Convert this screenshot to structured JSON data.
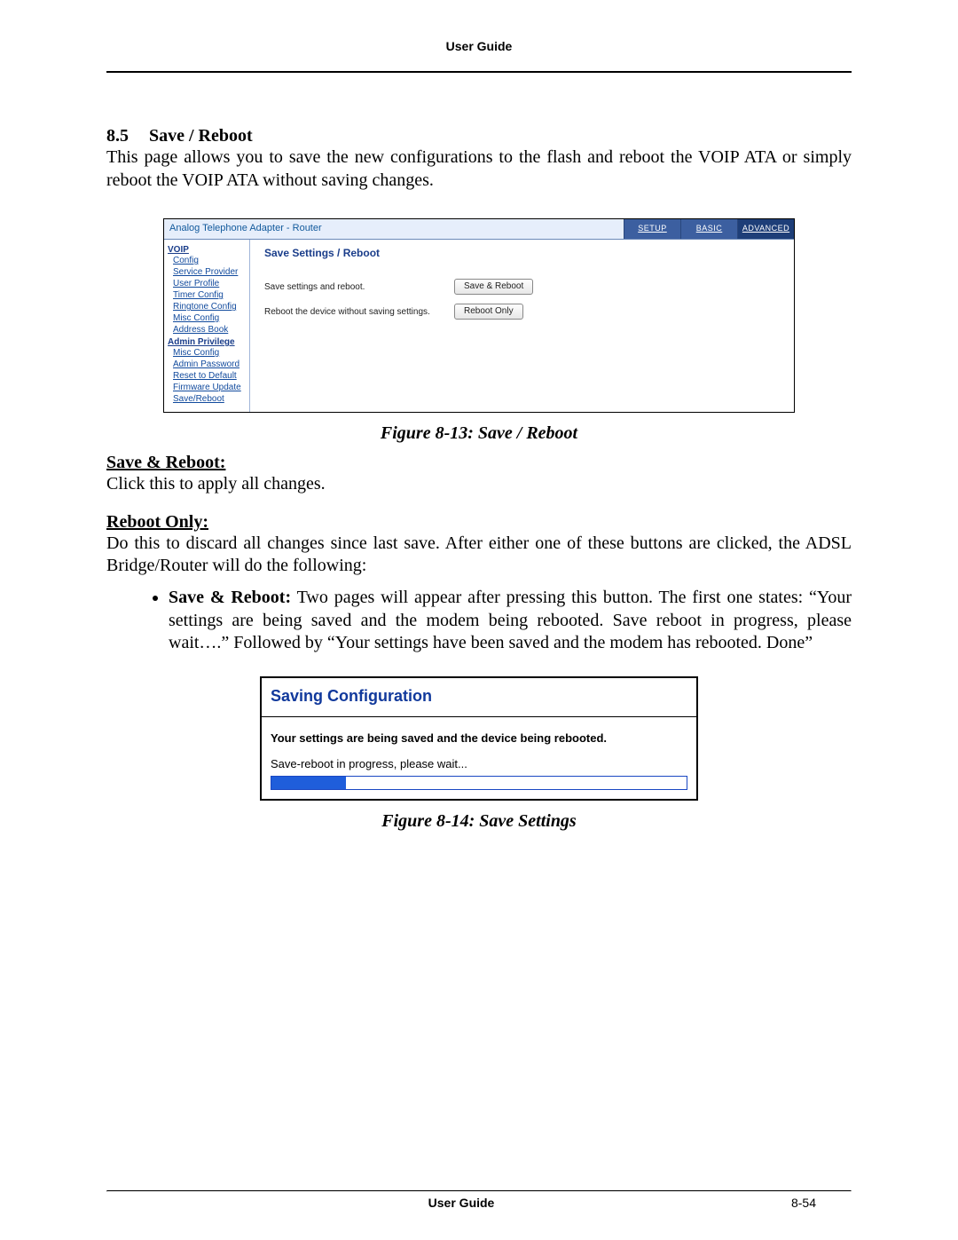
{
  "header": {
    "title": "User Guide"
  },
  "section": {
    "number": "8.5",
    "title": "Save / Reboot",
    "intro": "This page allows you to save the new configurations to the flash and reboot the VOIP ATA or simply reboot the VOIP ATA without saving changes."
  },
  "router_ui": {
    "window_title": "Analog Telephone Adapter - Router",
    "tabs": {
      "setup": "SETUP",
      "basic": "BASIC",
      "advanced": "ADVANCED"
    },
    "sidebar": {
      "group1_head": "VOIP",
      "group1": [
        "Config",
        "Service Provider",
        "User Profile",
        "Timer Config",
        "Ringtone Config",
        "Misc Config",
        "Address Book"
      ],
      "group2_head": "Admin Privilege",
      "group2": [
        "Misc Config",
        "Admin Password",
        "Reset to Default",
        "Firmware Update",
        "Save/Reboot"
      ]
    },
    "main": {
      "heading": "Save Settings / Reboot",
      "row1_label": "Save settings and reboot.",
      "row1_button": "Save & Reboot",
      "row2_label": "Reboot the device without saving settings.",
      "row2_button": "Reboot Only"
    }
  },
  "fig1_caption": "Figure 8-13: Save / Reboot",
  "save_reboot": {
    "heading": "Save & Reboot:",
    "text": "Click this to apply all changes."
  },
  "reboot_only": {
    "heading": "Reboot Only:",
    "text": "Do this to discard all changes since last save. After either one of these buttons are clicked, the ADSL Bridge/Router will do the following:"
  },
  "bullet1": {
    "lead": "Save & Reboot:",
    "text": " Two pages will appear after pressing this button. The first one states: “Your settings are being saved and the modem being rebooted. Save reboot in progress, please wait….” Followed by “Your settings have been saved and the modem has rebooted. Done”"
  },
  "saving_ui": {
    "title": "Saving Configuration",
    "bold_line": "Your settings are being saved and the device being rebooted.",
    "plain_line": "Save-reboot in progress, please wait...",
    "progress_pct": 18
  },
  "fig2_caption": "Figure 8-14: Save Settings",
  "footer": {
    "center": "User Guide",
    "right": "8-54"
  }
}
